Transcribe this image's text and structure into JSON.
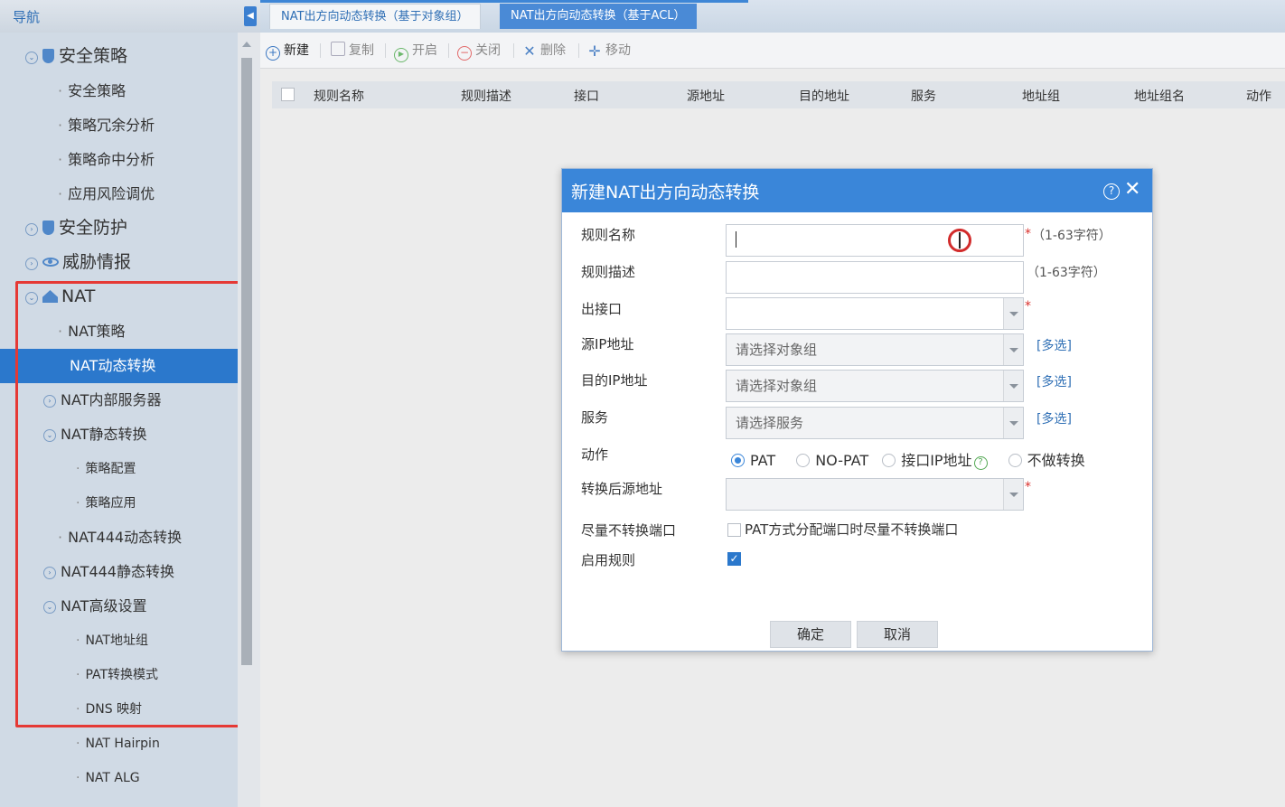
{
  "nav": {
    "title": "导航",
    "collapse_glyph": "◀"
  },
  "tabs": [
    {
      "label": "NAT出方向动态转换（基于对象组）",
      "active": true
    },
    {
      "label": "NAT出方向动态转换（基于ACL）",
      "active": false
    }
  ],
  "sidebar": {
    "items": [
      {
        "label": "安全策略",
        "icon": "shield-icon"
      },
      {
        "label": "安全策略"
      },
      {
        "label": "策略冗余分析"
      },
      {
        "label": "策略命中分析"
      },
      {
        "label": "应用风险调优"
      },
      {
        "label": "安全防护",
        "icon": "shield-icon"
      },
      {
        "label": "威胁情报",
        "icon": "eye-icon"
      },
      {
        "label": "NAT",
        "icon": "nat-icon"
      },
      {
        "label": "NAT策略"
      },
      {
        "label": "NAT动态转换",
        "selected": true
      },
      {
        "label": "NAT内部服务器"
      },
      {
        "label": "NAT静态转换"
      },
      {
        "label": "策略配置"
      },
      {
        "label": "策略应用"
      },
      {
        "label": "NAT444动态转换"
      },
      {
        "label": "NAT444静态转换"
      },
      {
        "label": "NAT高级设置"
      },
      {
        "label": "NAT地址组"
      },
      {
        "label": "PAT转换模式"
      },
      {
        "label": "DNS 映射"
      },
      {
        "label": "NAT Hairpin"
      },
      {
        "label": "NAT ALG"
      }
    ]
  },
  "toolbar": {
    "new": "新建",
    "copy": "复制",
    "enable": "开启",
    "disable": "关闭",
    "delete": "删除",
    "move": "移动"
  },
  "grid": {
    "columns": [
      "规则名称",
      "规则描述",
      "接口",
      "源地址",
      "目的地址",
      "服务",
      "地址组",
      "地址组名",
      "动作"
    ]
  },
  "dialog": {
    "title": "新建NAT出方向动态转换",
    "fields": {
      "rule_name": {
        "label": "规则名称",
        "value": "",
        "hint": "（1-63字符）"
      },
      "rule_desc": {
        "label": "规则描述",
        "value": "",
        "hint": "（1-63字符）"
      },
      "out_iface": {
        "label": "出接口",
        "value": ""
      },
      "src_ip": {
        "label": "源IP地址",
        "placeholder": "请选择对象组",
        "link": "[多选]"
      },
      "dst_ip": {
        "label": "目的IP地址",
        "placeholder": "请选择对象组",
        "link": "[多选]"
      },
      "service": {
        "label": "服务",
        "placeholder": "请选择服务",
        "link": "[多选]"
      },
      "action": {
        "label": "动作",
        "options": [
          "PAT",
          "NO-PAT",
          "接口IP地址",
          "不做转换"
        ],
        "selected": "PAT"
      },
      "trans_src": {
        "label": "转换后源地址",
        "value": ""
      },
      "no_port_trans": {
        "label": "尽量不转换端口",
        "checkbox_text": "PAT方式分配端口时尽量不转换端口",
        "checked": false
      },
      "enable_rule": {
        "label": "启用规则",
        "checked": true
      }
    },
    "required_mark": "*",
    "ok": "确定",
    "cancel": "取消"
  }
}
